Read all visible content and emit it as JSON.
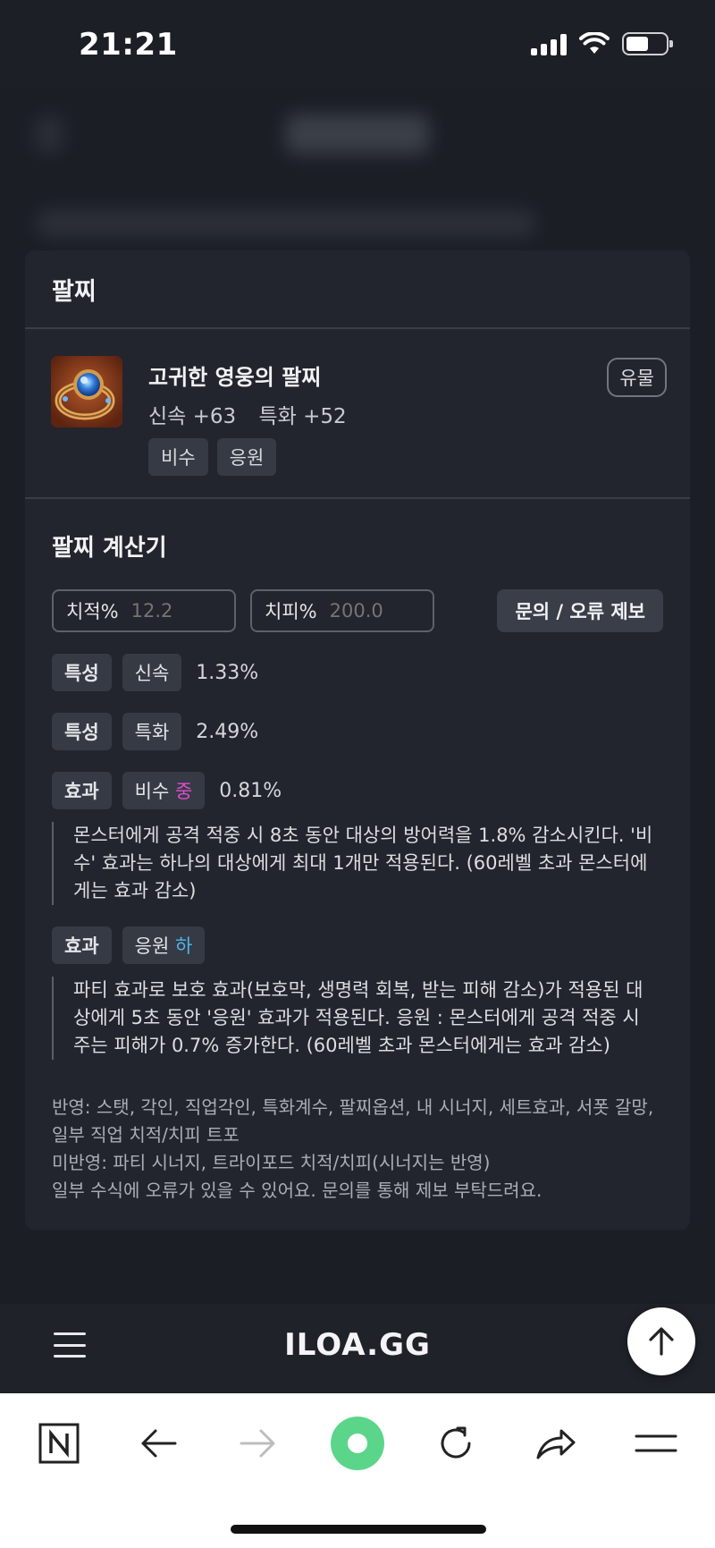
{
  "status_bar": {
    "time": "21:21"
  },
  "card": {
    "title": "팔찌",
    "item": {
      "name": "고귀한 영웅의 팔찌",
      "grade": "유물",
      "stats": [
        "신속 +63",
        "특화 +52"
      ],
      "tags": [
        "비수",
        "응원"
      ]
    },
    "calculator": {
      "title": "팔찌 계산기",
      "crit_rate": {
        "label": "치적%",
        "placeholder": "12.2"
      },
      "crit_dmg": {
        "label": "치피%",
        "placeholder": "200.0"
      },
      "report_button": "문의 / 오류 제보",
      "rows": [
        {
          "chip1": "특성",
          "chip2": "신속",
          "value": "1.33%"
        },
        {
          "chip1": "특성",
          "chip2": "특화",
          "value": "2.49%"
        }
      ],
      "effects": [
        {
          "chip1": "효과",
          "name": "비수",
          "level": "중",
          "level_color": "#e04ccf",
          "value": "0.81%",
          "description": "몬스터에게 공격 적중 시 8초 동안 대상의 방어력을 1.8% 감소시킨다. '비수' 효과는 하나의 대상에게 최대 1개만 적용된다. (60레벨 초과 몬스터에게는 효과 감소)"
        },
        {
          "chip1": "효과",
          "name": "응원",
          "level": "하",
          "level_color": "#4fb3ee",
          "value": "",
          "description": "파티 효과로 보호 효과(보호막, 생명력 회복, 받는 피해 감소)가 적용된 대상에게 5초 동안 '응원' 효과가 적용된다. 응원 : 몬스터에게 공격 적중 시 주는 피해가 0.7% 증가한다. (60레벨 초과 몬스터에게는 효과 감소)"
        }
      ],
      "notes": [
        "반영: 스탯, 각인, 직업각인, 특화계수, 팔찌옵션, 내 시너지, 세트효과, 서폿 갈망, 일부 직업 치적/치피 트포",
        "미반영: 파티 시너지, 트라이포드 치적/치피(시너지는 반영)",
        "일부 수식에 오류가 있을 수 있어요. 문의를 통해 제보 부탁드려요."
      ]
    }
  },
  "site_bar": {
    "logo": "ILOA.GG"
  },
  "icons": {
    "menu": "hamburger-menu-icon",
    "scroll_top": "arrow-up-icon",
    "browser": [
      "naver-n-icon",
      "back-arrow-icon",
      "forward-arrow-icon",
      "green-dot-icon",
      "reload-icon",
      "share-icon",
      "browser-menu-icon"
    ]
  },
  "colors": {
    "background": "#1b1e25",
    "card": "#22252d",
    "chip": "#363a44",
    "level_mid": "#e04ccf",
    "level_low": "#4fb3ee",
    "green_button": "#5bd58a"
  }
}
